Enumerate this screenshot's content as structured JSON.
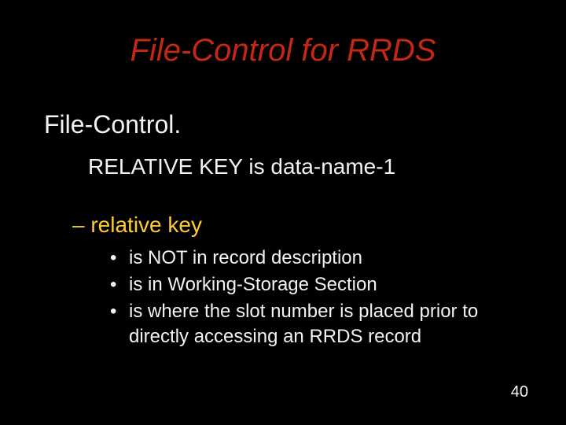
{
  "title": "File-Control for RRDS",
  "heading": "File-Control.",
  "keyLine": "RELATIVE KEY is data-name-1",
  "subhead": "– relative key",
  "bullets": [
    "is NOT in record description",
    "is in Working-Storage Section",
    "is where the slot number is placed prior to directly accessing an RRDS record"
  ],
  "pageNumber": "40"
}
